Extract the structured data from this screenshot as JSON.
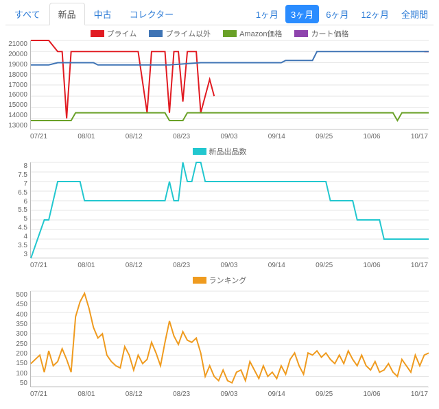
{
  "typeTabs": {
    "items": [
      {
        "label": "すべて"
      },
      {
        "label": "新品"
      },
      {
        "label": "中古"
      },
      {
        "label": "コレクター"
      }
    ],
    "activeIndex": 1
  },
  "periodTabs": {
    "items": [
      {
        "label": "1ヶ月"
      },
      {
        "label": "3ヶ月"
      },
      {
        "label": "6ヶ月"
      },
      {
        "label": "12ヶ月"
      },
      {
        "label": "全期間"
      }
    ],
    "activeIndex": 1
  },
  "legend_price": [
    {
      "name": "プライム",
      "color": "#e11b22"
    },
    {
      "name": "プライム以外",
      "color": "#3f74b5"
    },
    {
      "name": "Amazon価格",
      "color": "#6aa128"
    },
    {
      "name": "カート価格",
      "color": "#8e44ad"
    }
  ],
  "legend_count": [
    {
      "name": "新品出品数",
      "color": "#22c7cf"
    }
  ],
  "legend_rank": [
    {
      "name": "ランキング",
      "color": "#ef9b1f"
    }
  ],
  "chart_data": [
    {
      "type": "line",
      "title": "",
      "x_categories": [
        "07/21",
        "08/01",
        "08/12",
        "08/23",
        "09/03",
        "09/14",
        "09/25",
        "10/06",
        "10/17"
      ],
      "ylim": [
        13000,
        21000
      ],
      "y_ticks": [
        13000,
        14000,
        15000,
        16000,
        17000,
        18000,
        19000,
        20000,
        21000
      ],
      "series": [
        {
          "name": "プライム",
          "color": "#e11b22",
          "points": [
            [
              0,
              21000
            ],
            [
              4,
              21000
            ],
            [
              6,
              20000
            ],
            [
              7,
              20000
            ],
            [
              8,
              14000
            ],
            [
              9,
              20000
            ],
            [
              16,
              20000
            ],
            [
              24,
              20000
            ],
            [
              26,
              14500
            ],
            [
              27,
              20000
            ],
            [
              30,
              20000
            ],
            [
              31,
              14500
            ],
            [
              32,
              20000
            ],
            [
              33,
              20000
            ],
            [
              34,
              15500
            ],
            [
              35,
              20000
            ],
            [
              37,
              20000
            ],
            [
              38,
              14500
            ],
            [
              39,
              16000
            ],
            [
              40,
              17500
            ],
            [
              41,
              16000
            ],
            [
              88,
              null
            ],
            [
              88,
              20000
            ],
            [
              89,
              20000
            ]
          ]
        },
        {
          "name": "プライム以外",
          "color": "#3f74b5",
          "points": [
            [
              0,
              18800
            ],
            [
              4,
              18800
            ],
            [
              6,
              19000
            ],
            [
              14,
              19000
            ],
            [
              15,
              18800
            ],
            [
              30,
              18800
            ],
            [
              31,
              18800
            ],
            [
              38,
              19000
            ],
            [
              56,
              19000
            ],
            [
              57,
              19200
            ],
            [
              63,
              19200
            ],
            [
              64,
              20000
            ],
            [
              88,
              20000
            ],
            [
              89,
              20000
            ]
          ]
        },
        {
          "name": "Amazon価格",
          "color": "#6aa128",
          "points": [
            [
              0,
              13800
            ],
            [
              9,
              13800
            ],
            [
              10,
              14500
            ],
            [
              30,
              14500
            ],
            [
              31,
              13800
            ],
            [
              34,
              13800
            ],
            [
              35,
              14500
            ],
            [
              81,
              14500
            ],
            [
              82,
              13800
            ],
            [
              83,
              14500
            ],
            [
              88,
              14500
            ],
            [
              89,
              14500
            ]
          ]
        },
        {
          "name": "カート価格",
          "color": "#8e44ad",
          "points": []
        }
      ]
    },
    {
      "type": "line",
      "x_categories": [
        "07/21",
        "08/01",
        "08/12",
        "08/23",
        "09/03",
        "09/14",
        "09/25",
        "10/06",
        "10/17"
      ],
      "ylim": [
        3.0,
        8.0
      ],
      "y_ticks": [
        3.0,
        3.5,
        4.0,
        4.5,
        5.0,
        5.5,
        6.0,
        6.5,
        7.0,
        7.5,
        8.0
      ],
      "series": [
        {
          "name": "新品出品数",
          "color": "#22c7cf",
          "points": [
            [
              0,
              3
            ],
            [
              3,
              5
            ],
            [
              4,
              5
            ],
            [
              5,
              6
            ],
            [
              6,
              7
            ],
            [
              11,
              7
            ],
            [
              12,
              6
            ],
            [
              30,
              6
            ],
            [
              31,
              7
            ],
            [
              32,
              6
            ],
            [
              33,
              6
            ],
            [
              34,
              8
            ],
            [
              35,
              7
            ],
            [
              36,
              7
            ],
            [
              37,
              8
            ],
            [
              38,
              8
            ],
            [
              39,
              7
            ],
            [
              66,
              7
            ],
            [
              67,
              6
            ],
            [
              72,
              6
            ],
            [
              73,
              5
            ],
            [
              78,
              5
            ],
            [
              79,
              4
            ],
            [
              88,
              4
            ],
            [
              89,
              4
            ]
          ]
        }
      ]
    },
    {
      "type": "line",
      "x_categories": [
        "07/21",
        "08/01",
        "08/12",
        "08/23",
        "09/03",
        "09/14",
        "09/25",
        "10/06",
        "10/17"
      ],
      "ylim": [
        50,
        500
      ],
      "y_ticks": [
        50,
        100,
        150,
        200,
        250,
        300,
        350,
        400,
        450,
        500
      ],
      "series": [
        {
          "name": "ランキング",
          "color": "#ef9b1f",
          "points": [
            [
              0,
              160
            ],
            [
              2,
              200
            ],
            [
              3,
              120
            ],
            [
              4,
              220
            ],
            [
              5,
              150
            ],
            [
              6,
              170
            ],
            [
              7,
              230
            ],
            [
              8,
              180
            ],
            [
              9,
              120
            ],
            [
              10,
              380
            ],
            [
              11,
              450
            ],
            [
              12,
              490
            ],
            [
              13,
              420
            ],
            [
              14,
              330
            ],
            [
              15,
              280
            ],
            [
              16,
              300
            ],
            [
              17,
              200
            ],
            [
              18,
              170
            ],
            [
              19,
              150
            ],
            [
              20,
              140
            ],
            [
              21,
              240
            ],
            [
              22,
              200
            ],
            [
              23,
              130
            ],
            [
              24,
              200
            ],
            [
              25,
              160
            ],
            [
              26,
              180
            ],
            [
              27,
              260
            ],
            [
              28,
              210
            ],
            [
              29,
              150
            ],
            [
              30,
              260
            ],
            [
              31,
              360
            ],
            [
              32,
              290
            ],
            [
              33,
              250
            ],
            [
              34,
              310
            ],
            [
              35,
              270
            ],
            [
              36,
              260
            ],
            [
              37,
              280
            ],
            [
              38,
              210
            ],
            [
              39,
              100
            ],
            [
              40,
              150
            ],
            [
              41,
              100
            ],
            [
              42,
              80
            ],
            [
              43,
              130
            ],
            [
              44,
              80
            ],
            [
              45,
              70
            ],
            [
              46,
              120
            ],
            [
              47,
              130
            ],
            [
              48,
              80
            ],
            [
              49,
              170
            ],
            [
              50,
              130
            ],
            [
              51,
              90
            ],
            [
              52,
              150
            ],
            [
              53,
              100
            ],
            [
              54,
              120
            ],
            [
              55,
              90
            ],
            [
              56,
              150
            ],
            [
              57,
              110
            ],
            [
              58,
              180
            ],
            [
              59,
              210
            ],
            [
              60,
              150
            ],
            [
              61,
              110
            ],
            [
              62,
              210
            ],
            [
              63,
              200
            ],
            [
              64,
              220
            ],
            [
              65,
              190
            ],
            [
              66,
              210
            ],
            [
              67,
              180
            ],
            [
              68,
              160
            ],
            [
              69,
              200
            ],
            [
              70,
              160
            ],
            [
              71,
              220
            ],
            [
              72,
              180
            ],
            [
              73,
              150
            ],
            [
              74,
              200
            ],
            [
              75,
              150
            ],
            [
              76,
              130
            ],
            [
              77,
              170
            ],
            [
              78,
              120
            ],
            [
              79,
              130
            ],
            [
              80,
              160
            ],
            [
              81,
              120
            ],
            [
              82,
              100
            ],
            [
              83,
              180
            ],
            [
              84,
              150
            ],
            [
              85,
              120
            ],
            [
              86,
              200
            ],
            [
              87,
              150
            ],
            [
              88,
              200
            ],
            [
              89,
              210
            ]
          ]
        }
      ]
    }
  ]
}
